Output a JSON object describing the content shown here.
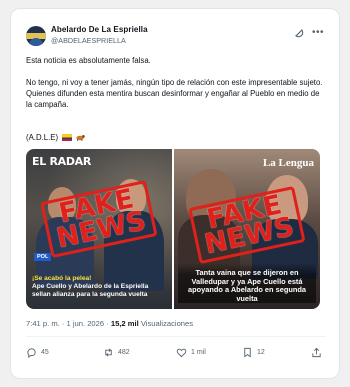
{
  "author": {
    "name": "Abelardo De La Espriella",
    "handle": "@ABDELAESPRIELLA"
  },
  "post": {
    "line1": "Esta noticia es absolutamente falsa.",
    "line2": "No tengo, ni voy a tener  jamás, ningún tipo de relación con este impresentable sujeto. Quienes difunden esta mentira buscan desinformar y engañar al Pueblo en medio de la campaña.",
    "signature": "(A.D.L.E)"
  },
  "media": {
    "left": {
      "brand": "EL RADAR",
      "tag": "POL",
      "stamp_line1": "FAKE",
      "stamp_line2": "NEWS",
      "caption_highlight": "¡Se acabó la pelea!",
      "caption": "Ape Cuello y Abelardo de la Espriella sellan alianza para la segunda vuelta"
    },
    "right": {
      "brand": "La Lengua",
      "stamp_line1": "FAKE",
      "stamp_line2": "NEWS",
      "caption": "Tanta vaina que se dijeron en Valledupar y ya Ape Cuello está apoyando a Abelardo en segunda vuelta"
    }
  },
  "meta": {
    "time": "7:41 p. m. · 1 jun. 2026 · ",
    "views_count": "15,2 mil",
    "views_label": " Visualizaciones"
  },
  "actions": {
    "replies": "45",
    "reposts": "482",
    "likes": "1 mil",
    "bookmarks": "12"
  },
  "icons": [
    "grok-icon",
    "more-icon",
    "colombia-flag-icon",
    "cow-icon",
    "reply-icon",
    "repost-icon",
    "like-icon",
    "bookmark-icon",
    "share-icon"
  ],
  "colors": {
    "stamp": "#e0211b",
    "muted": "#536471",
    "text": "#0f1419"
  }
}
